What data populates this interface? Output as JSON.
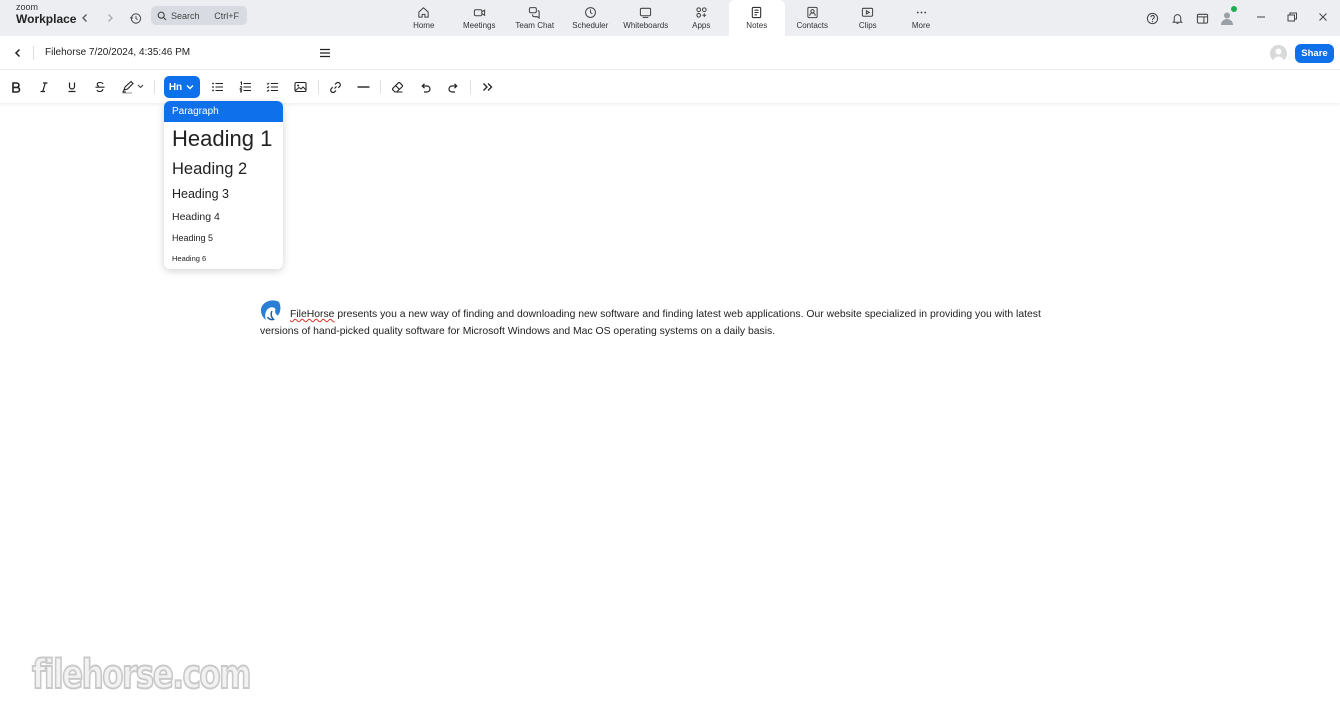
{
  "app": {
    "brand_small": "zoom",
    "brand_big": "Workplace"
  },
  "search": {
    "placeholder": "Search",
    "shortcut": "Ctrl+F"
  },
  "nav_tabs": [
    {
      "label": "Home",
      "icon": "home-icon"
    },
    {
      "label": "Meetings",
      "icon": "video-camera-icon"
    },
    {
      "label": "Team Chat",
      "icon": "chat-bubbles-icon"
    },
    {
      "label": "Scheduler",
      "icon": "clock-icon"
    },
    {
      "label": "Whiteboards",
      "icon": "whiteboard-icon"
    },
    {
      "label": "Apps",
      "icon": "apps-icon"
    },
    {
      "label": "Notes",
      "icon": "notes-icon",
      "active": true
    },
    {
      "label": "Contacts",
      "icon": "contacts-icon"
    },
    {
      "label": "Clips",
      "icon": "clips-icon"
    },
    {
      "label": "More",
      "icon": "more-dots-icon"
    }
  ],
  "document": {
    "title": "Filehorse 7/20/2024, 4:35:46 PM",
    "share_label": "Share"
  },
  "toolbar": {
    "heading_button_label": "Hn"
  },
  "heading_menu": {
    "items": [
      "Paragraph",
      "Heading 1",
      "Heading 2",
      "Heading 3",
      "Heading 4",
      "Heading 5",
      "Heading 6"
    ],
    "selected": "Paragraph"
  },
  "content": {
    "misspelled_word": "FileHorse",
    "paragraph_rest": " presents you a new way of finding and downloading new software and finding latest web applications. Our website specialized in providing you with latest versions of hand-picked quality software for Microsoft Windows and Mac OS operating systems on a daily basis."
  },
  "watermark": {
    "text": "filehorse.com"
  },
  "colors": {
    "accent": "#0e71eb",
    "titlebar_bg": "#eceef2",
    "online_status": "#1fae52",
    "spellcheck": "#d93025"
  }
}
